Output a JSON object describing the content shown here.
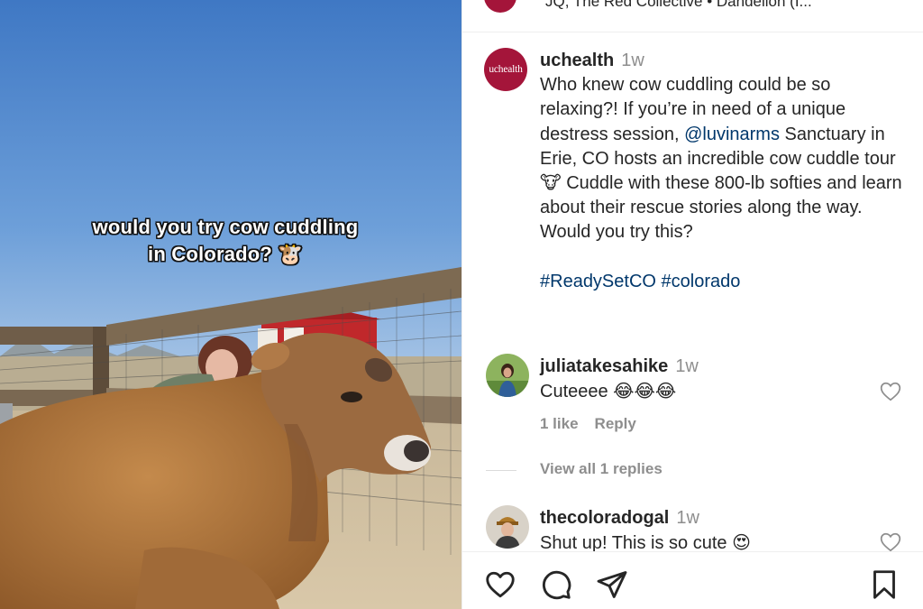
{
  "media": {
    "overlay_line1": "would you try cow cuddling",
    "overlay_line2": "in Colorado? 🐮"
  },
  "top": {
    "text": "JQ, The Red Collective • Dandelion (I..."
  },
  "post": {
    "avatar_label": "uchealth",
    "username": "uchealth",
    "time": "1w",
    "caption_part1": "Who knew cow cuddling could be so relaxing?! If you’re in need of a unique destress session, ",
    "mention": "@luvinarms",
    "caption_part2": " Sanctuary in Erie, CO hosts an incredible cow cuddle tour 🐮 Cuddle with these 800-lb softies and learn about their rescue stories along the way.",
    "caption_part3": "Would you try this?",
    "hashtags": "#ReadySetCO #colorado"
  },
  "comments": [
    {
      "username": "juliatakesahike",
      "time": "1w",
      "text": "Cuteeee 😂😂😂",
      "likes": "1 like",
      "reply": "Reply"
    },
    {
      "username": "thecoloradogal",
      "time": "1w",
      "text": "Shut up! This is so cute 😍"
    }
  ],
  "view_replies": "View all 1 replies",
  "colors": {
    "brand": "#a4153a",
    "link": "#00376b",
    "muted": "#8e8e8e"
  },
  "icons": [
    "heart-icon",
    "comment-icon",
    "share-icon",
    "bookmark-icon"
  ]
}
